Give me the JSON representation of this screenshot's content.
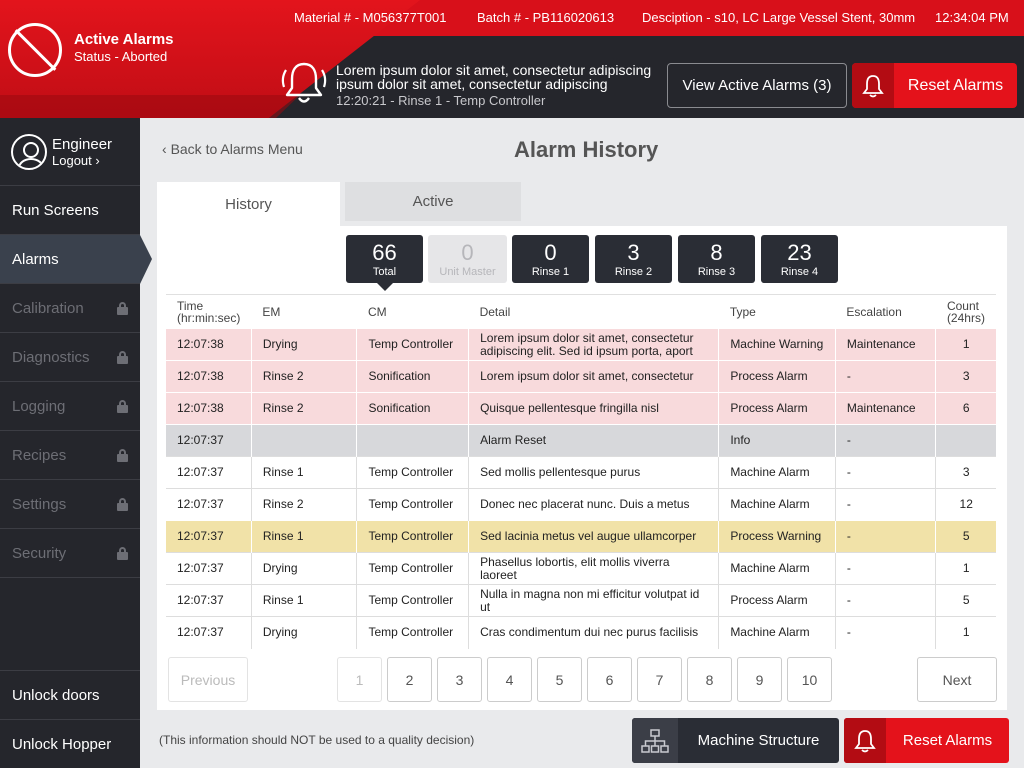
{
  "header": {
    "status_title": "Active Alarms",
    "status_subtitle": "Status - Aborted",
    "material": "Material # - M056377T001",
    "batch": "Batch # - PB116020613",
    "description": "Desciption - s10, LC Large Vessel Stent, 30mm",
    "time": "12:34:04 PM",
    "alarm_message": "Lorem ipsum dolor sit amet, consectetur adipiscing ipsum dolor sit amet, consectetur adipiscing",
    "alarm_meta": "12:20:21 - Rinse 1 - Temp Controller",
    "view_alarms_label": "View Active Alarms (3)",
    "reset_label": "Reset Alarms",
    "accent_color": "#e4121b"
  },
  "sidebar": {
    "user_name": "Engineer",
    "logout_label": "Logout",
    "items": [
      {
        "label": "Run Screens",
        "locked": false,
        "active": false
      },
      {
        "label": "Alarms",
        "locked": false,
        "active": true
      },
      {
        "label": "Calibration",
        "locked": true,
        "active": false
      },
      {
        "label": "Diagnostics",
        "locked": true,
        "active": false
      },
      {
        "label": "Logging",
        "locked": true,
        "active": false
      },
      {
        "label": "Recipes",
        "locked": true,
        "active": false
      },
      {
        "label": "Settings",
        "locked": true,
        "active": false
      },
      {
        "label": "Security",
        "locked": true,
        "active": false
      }
    ],
    "unlock_doors": "Unlock doors",
    "unlock_hopper": "Unlock Hopper"
  },
  "main": {
    "back_label": "Back to Alarms Menu",
    "title": "Alarm History",
    "tabs": [
      {
        "label": "History",
        "selected": true
      },
      {
        "label": "Active",
        "selected": false
      }
    ],
    "counts": [
      {
        "value": "66",
        "label": "Total",
        "selected": true,
        "disabled": false
      },
      {
        "value": "0",
        "label": "Unit Master",
        "selected": false,
        "disabled": true
      },
      {
        "value": "0",
        "label": "Rinse 1",
        "selected": false,
        "disabled": false
      },
      {
        "value": "3",
        "label": "Rinse 2",
        "selected": false,
        "disabled": false
      },
      {
        "value": "8",
        "label": "Rinse 3",
        "selected": false,
        "disabled": false
      },
      {
        "value": "23",
        "label": "Rinse 4",
        "selected": false,
        "disabled": false
      }
    ],
    "columns": {
      "time": "Time",
      "time_unit": "(hr:min:sec)",
      "em": "EM",
      "cm": "CM",
      "detail": "Detail",
      "type": "Type",
      "escalation": "Escalation",
      "count": "Count",
      "count_unit": "(24hrs)"
    },
    "rows": [
      {
        "time": "12:07:38",
        "em": "Drying",
        "cm": "Temp Controller",
        "detail": "Lorem ipsum dolor sit amet, consectetur adipiscing elit. Sed id ipsum porta, aport",
        "type": "Machine Warning",
        "escalation": "Maintenance",
        "count": "1",
        "style": "red"
      },
      {
        "time": "12:07:38",
        "em": "Rinse 2",
        "cm": "Sonification",
        "detail": "Lorem ipsum dolor sit amet, consectetur",
        "type": "Process Alarm",
        "escalation": "-",
        "count": "3",
        "style": "red"
      },
      {
        "time": "12:07:38",
        "em": "Rinse 2",
        "cm": "Sonification",
        "detail": "Quisque pellentesque fringilla nisl",
        "type": "Process Alarm",
        "escalation": "Maintenance",
        "count": "6",
        "style": "red"
      },
      {
        "time": "12:07:37",
        "em": "",
        "cm": "",
        "detail": "Alarm Reset",
        "type": "Info",
        "escalation": "-",
        "count": "",
        "style": "grey"
      },
      {
        "time": "12:07:37",
        "em": "Rinse 1",
        "cm": "Temp Controller",
        "detail": "Sed mollis pellentesque purus",
        "type": "Machine Alarm",
        "escalation": "-",
        "count": "3",
        "style": "plain"
      },
      {
        "time": "12:07:37",
        "em": "Rinse 2",
        "cm": "Temp Controller",
        "detail": "Donec nec placerat nunc. Duis a metus",
        "type": "Machine Alarm",
        "escalation": "-",
        "count": "12",
        "style": "plain"
      },
      {
        "time": "12:07:37",
        "em": "Rinse 1",
        "cm": "Temp Controller",
        "detail": "Sed lacinia metus vel augue ullamcorper",
        "type": "Process Warning",
        "escalation": "-",
        "count": "5",
        "style": "yellow"
      },
      {
        "time": "12:07:37",
        "em": "Drying",
        "cm": "Temp Controller",
        "detail": "Phasellus lobortis, elit mollis viverra laoreet",
        "type": "Machine Alarm",
        "escalation": "-",
        "count": "1",
        "style": "plain"
      },
      {
        "time": "12:07:37",
        "em": "Rinse 1",
        "cm": "Temp Controller",
        "detail": "Nulla in magna non mi efficitur volutpat id ut",
        "type": "Process Alarm",
        "escalation": "-",
        "count": "5",
        "style": "plain"
      },
      {
        "time": "12:07:37",
        "em": "Drying",
        "cm": "Temp Controller",
        "detail": "Cras condimentum dui nec purus facilisis",
        "type": "Machine Alarm",
        "escalation": "-",
        "count": "1",
        "style": "plain"
      }
    ],
    "pagination": {
      "previous_label": "Previous",
      "next_label": "Next",
      "pages": [
        "1",
        "2",
        "3",
        "4",
        "5",
        "6",
        "7",
        "8",
        "9",
        "10"
      ],
      "current_page": "1"
    }
  },
  "footer": {
    "disclaimer": "(This information should NOT be used to a quality decision)",
    "machine_structure_label": "Machine Structure",
    "reset_label": "Reset Alarms"
  }
}
